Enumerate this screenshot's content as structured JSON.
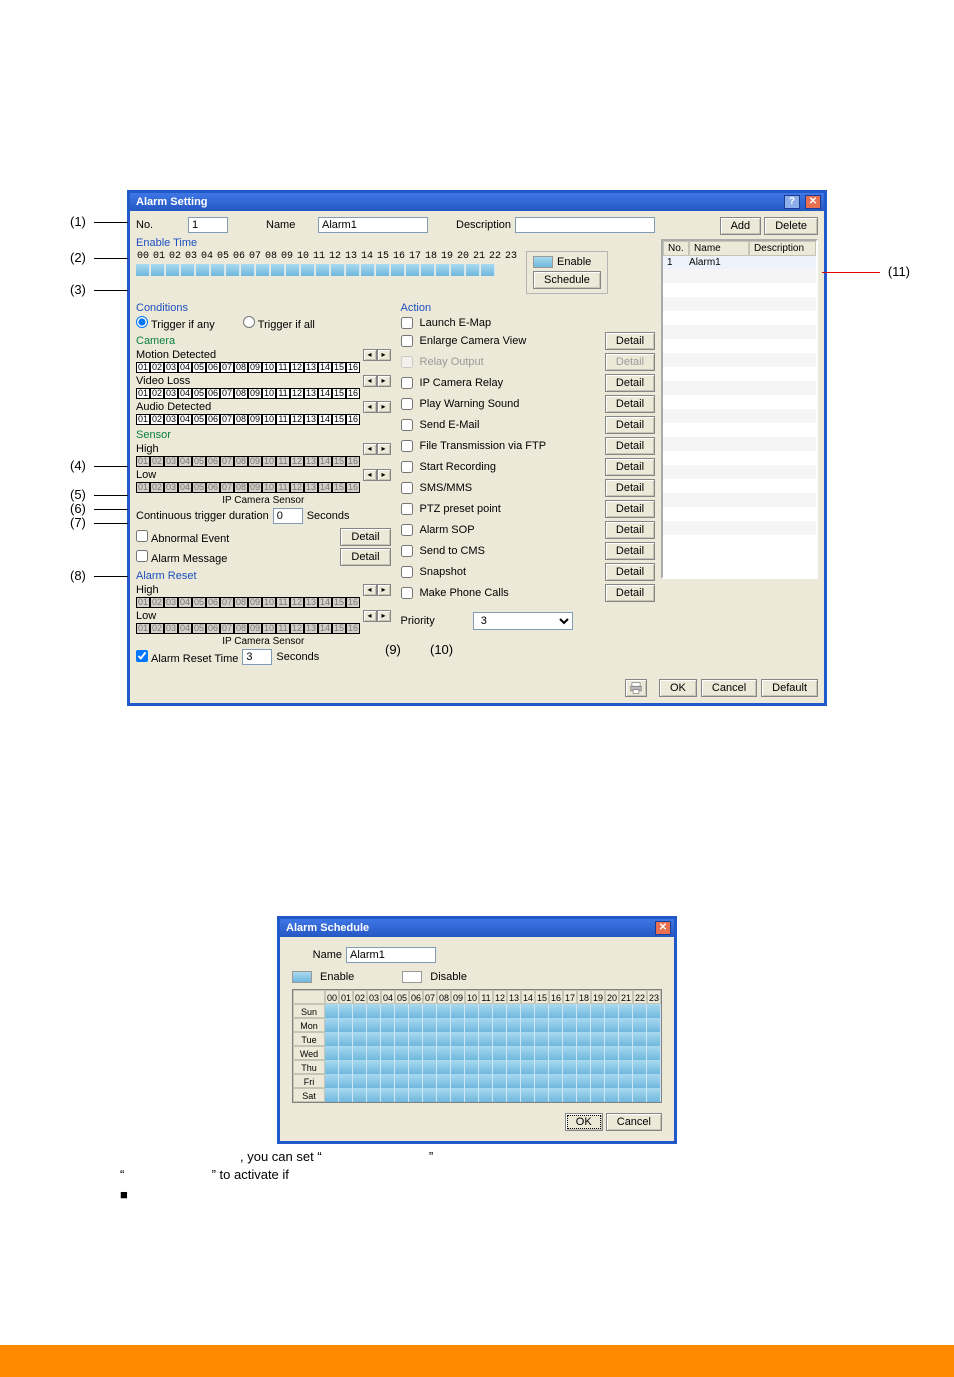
{
  "callouts": {
    "c1": "(1)",
    "c2": "(2)",
    "c3": "(3)",
    "c4": "(4)",
    "c5": "(5)",
    "c6": "(6)",
    "c7": "(7)",
    "c8": "(8)",
    "c9": "(9)",
    "c10": "(10)",
    "c11": "(11)"
  },
  "dlg": {
    "title": "Alarm Setting",
    "no_label": "No.",
    "no_value": "1",
    "name_label": "Name",
    "name_value": "Alarm1",
    "desc_label": "Description",
    "desc_value": "",
    "add": "Add",
    "delete": "Delete",
    "enable_time": "Enable Time",
    "hours": [
      "00",
      "01",
      "02",
      "03",
      "04",
      "05",
      "06",
      "07",
      "08",
      "09",
      "10",
      "11",
      "12",
      "13",
      "14",
      "15",
      "16",
      "17",
      "18",
      "19",
      "20",
      "21",
      "22",
      "23"
    ],
    "enable_legend": "Enable",
    "schedule_btn": "Schedule",
    "conditions": "Conditions",
    "trigger_any": "Trigger if any",
    "trigger_all": "Trigger if all",
    "camera": "Camera",
    "motion_detected": "Motion Detected",
    "video_loss": "Video Loss",
    "audio_detected": "Audio Detected",
    "cam_cells": [
      "01",
      "02",
      "03",
      "04",
      "05",
      "06",
      "07",
      "08",
      "09",
      "10",
      "11",
      "12",
      "13",
      "14",
      "15",
      "16"
    ],
    "sensor": "Sensor",
    "high": "High",
    "low": "Low",
    "sensor_cells": [
      "01",
      "02",
      "03",
      "04",
      "05",
      "06",
      "07",
      "08",
      "09",
      "10",
      "11",
      "12",
      "13",
      "14",
      "15",
      "16"
    ],
    "ip_camera_sensor": "IP Camera Sensor",
    "continuous": "Continuous trigger duration",
    "continuous_value": "0",
    "seconds": "Seconds",
    "abnormal_event": "Abnormal Event",
    "alarm_message": "Alarm Message",
    "detail": "Detail",
    "alarm_reset": "Alarm Reset",
    "alarm_reset_time": "Alarm Reset Time",
    "alarm_reset_value": "3",
    "action": "Action",
    "actions": {
      "launch_emap": "Launch E-Map",
      "enlarge_camera": "Enlarge Camera View",
      "relay_output": "Relay Output",
      "ip_camera_relay": "IP Camera Relay",
      "play_warning": "Play Warning Sound",
      "send_email": "Send E-Mail",
      "file_ftp": "File Transmission via FTP",
      "start_recording": "Start Recording",
      "sms_mms": "SMS/MMS",
      "ptz_preset": "PTZ preset point",
      "alarm_sop": "Alarm SOP",
      "send_to_cms": "Send to CMS",
      "snapshot": "Snapshot",
      "make_phone": "Make Phone Calls"
    },
    "priority": "Priority",
    "priority_value": "3",
    "print_btn": "",
    "ok": "OK",
    "cancel": "Cancel",
    "default": "Default",
    "list": {
      "h_no": "No.",
      "h_name": "Name",
      "h_desc": "Description",
      "row_no": "1",
      "row_name": "Alarm1",
      "row_desc": ""
    }
  },
  "sched": {
    "title": "Alarm Schedule",
    "name_label": "Name",
    "name_value": "Alarm1",
    "enable": "Enable",
    "disable": "Disable",
    "hours": [
      "00",
      "01",
      "02",
      "03",
      "04",
      "05",
      "06",
      "07",
      "08",
      "09",
      "10",
      "11",
      "12",
      "13",
      "14",
      "15",
      "16",
      "17",
      "18",
      "19",
      "20",
      "21",
      "22",
      "23"
    ],
    "days": [
      "Sun",
      "Mon",
      "Tue",
      "Wed",
      "Thu",
      "Fri",
      "Sat"
    ],
    "ok": "OK",
    "cancel": "Cancel"
  },
  "narr": {
    "line1a": ", you can set “",
    "line1b": "”",
    "line2a": "“",
    "line2b": "” to activate if",
    "bullet": "■"
  },
  "footer": {
    "page": ""
  }
}
